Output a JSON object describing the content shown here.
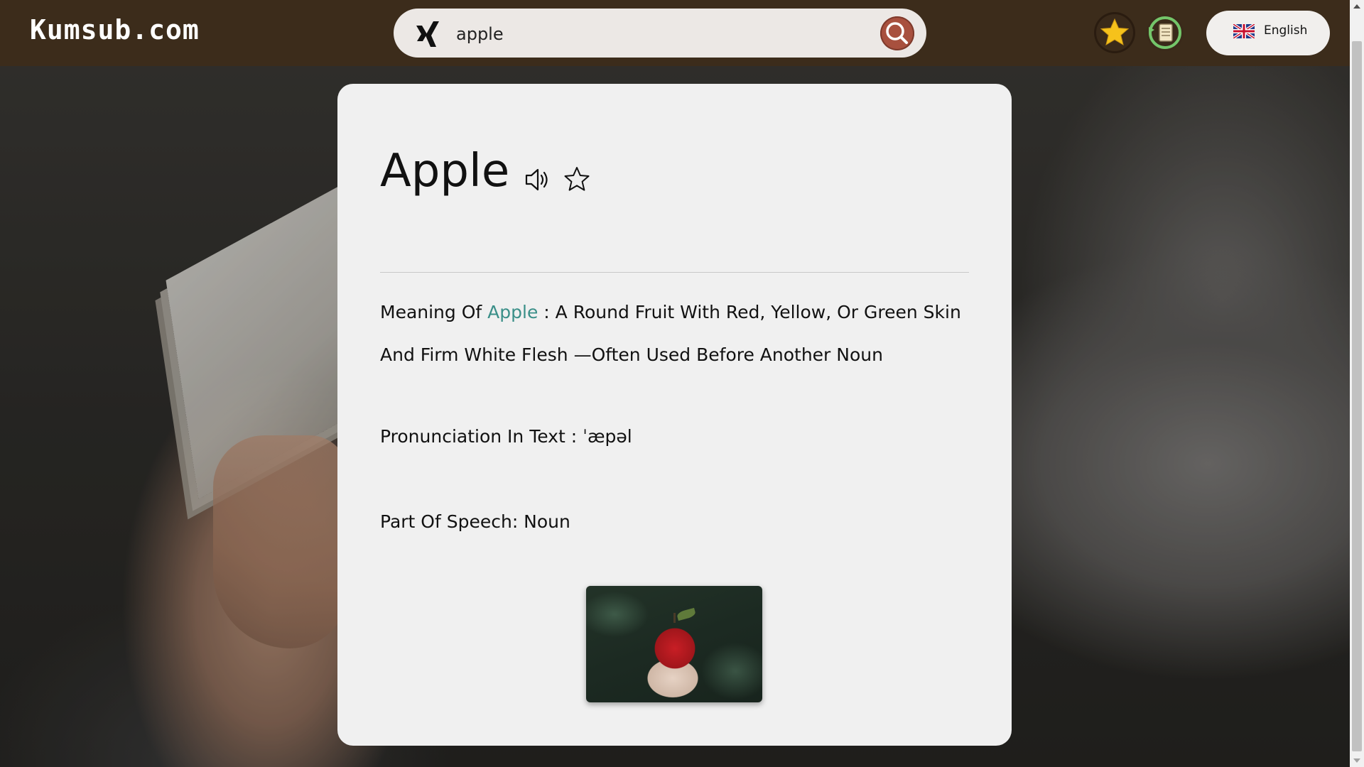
{
  "header": {
    "logo_text": "Kumsub.com",
    "search": {
      "value": "apple",
      "placeholder": ""
    },
    "language_label": "English",
    "icons": {
      "search_provider": "xing-icon",
      "search": "search-icon",
      "favorites": "star-icon",
      "history": "history-icon",
      "language_flag": "uk-flag-icon"
    }
  },
  "entry": {
    "word": "Apple",
    "meaning_label": "Meaning Of",
    "meaning_word": "Apple",
    "meaning_sep": ":",
    "meaning_text": "A Round Fruit With Red, Yellow, Or Green Skin And Firm White Flesh —Often Used Before Another Noun",
    "pronunciation_label": "Pronunciation In Text :",
    "pronunciation_value": "ˈæpəl",
    "part_of_speech": "Part Of Speech: Noun",
    "image_subject": "red apple in hand"
  },
  "colors": {
    "header_bg": "#3c2c1b",
    "highlight": "#3a8f88",
    "search_button": "#a8503e",
    "card_bg": "#f0f0f0"
  }
}
